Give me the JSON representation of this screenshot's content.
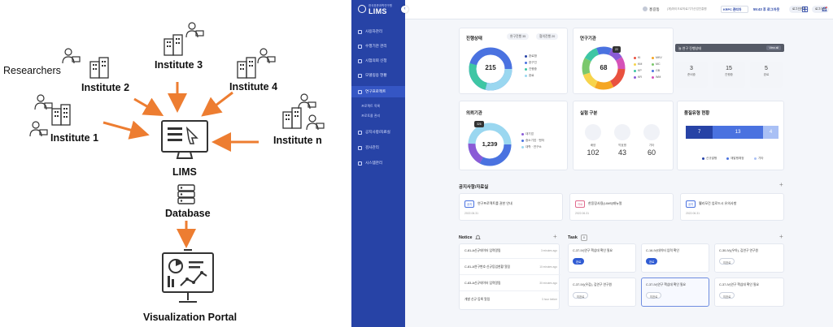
{
  "diagram": {
    "researchers_label": "Researchers",
    "institutes": [
      "Institute 1",
      "Institute 2",
      "Institute 3",
      "Institute 4",
      "Institute n"
    ],
    "lims_label": "LIMS",
    "database_label": "Database",
    "portal_label": "Visualization Portal",
    "arrow_color": "#ed7d31"
  },
  "app": {
    "brand": {
      "subtitle": "한국표준과학연구원",
      "name": "LIMS"
    },
    "sidebar": {
      "items": [
        "사용자관리",
        "수행기관 관리",
        "시험의뢰 신청",
        "모델링용 현황",
        "연구프로젝트",
        "공지사항/자료실",
        "검사관리",
        "시스템관리"
      ],
      "subitems": [
        "프로젝트 목록",
        "프로토콜 관리"
      ]
    },
    "topbar": {
      "user": "홍길동",
      "institution": "(재)마이크로의료기기산업진흥원",
      "select": "KRPC 관리자",
      "time": "55:43 후 로그아웃",
      "extend": "로그인연장",
      "logout": "로그아웃"
    },
    "progress": {
      "title": "진행상태",
      "pill1": "완구진행 35",
      "pill2": "협의진행 20",
      "total": "215",
      "legend": [
        "완료함",
        "완구진",
        "진행중",
        "완료"
      ]
    },
    "institutes_card": {
      "title": "연구기관",
      "total": "68",
      "tag": "22",
      "legend": [
        "KI",
        "MKV",
        "KM",
        "MC",
        "KP",
        "GB",
        "KR",
        "WM"
      ]
    },
    "status_card": {
      "header": "늘 연구 진행상태",
      "view_all": "View all",
      "boxes": [
        {
          "num": "3",
          "label": "준비중"
        },
        {
          "num": "15",
          "label": "진행중"
        },
        {
          "num": "5",
          "label": "완료"
        }
      ]
    },
    "requester_card": {
      "title": "의뢰기관",
      "total": "1,239",
      "tag": "326",
      "legend": [
        "대기업",
        "중소기업 · 벤처",
        "대학 · 연구소"
      ]
    },
    "experiment_card": {
      "title": "실험 구분",
      "items": [
        {
          "label": "배양",
          "num": "102"
        },
        {
          "label": "약효평",
          "num": "43"
        },
        {
          "label": "기타",
          "num": "60"
        }
      ]
    },
    "quality_card": {
      "title": "품질유형 현황",
      "segments": [
        {
          "value": 7,
          "color": "#2743a6"
        },
        {
          "value": 13,
          "color": "#4a72e0"
        },
        {
          "value": 4,
          "color": "#a9c0f5"
        }
      ],
      "legend": [
        "신규발행",
        "재발행예정",
        "기타"
      ]
    },
    "notices_section": {
      "title": "공지사항/자료실",
      "cards": [
        {
          "tag": "공지",
          "text": "연구프로젝트를 권한 안내",
          "date": "2022.06.31"
        },
        {
          "tag": "자료",
          "text": "한웅장사용(LIMS)매뉴얼",
          "date": "2022.06.31"
        },
        {
          "tag": "공지",
          "text": "웰리모건 업로드시 유의사항",
          "date": "2022.06.31"
        }
      ]
    },
    "notice_list": {
      "title": "Notice",
      "rows": [
        {
          "text": "C-81-A신규데이터 입력알림",
          "ago": "3 minutes ago"
        },
        {
          "text": "C-81-A연구변호 신규등업현황 알림",
          "ago": "10 minutes ago"
        },
        {
          "text": "C-83-A신규데이터 입력알림",
          "ago": "30 minutes ago"
        },
        {
          "text": "개발 신규 등록 알림",
          "ago": "3 hour before"
        }
      ]
    },
    "task_section": {
      "title": "Task",
      "count": "8",
      "cards": [
        {
          "text": "C-37-IV)연구 핵심데 확인 필요",
          "btn": "완료"
        },
        {
          "text": "C-16-IV)데이터 입력 확인",
          "btn": "완료"
        },
        {
          "text": "C-30-IV)(우아), 김연구 연구원",
          "btn": "미완료"
        },
        {
          "text": "C-37-IV)(우감), 김연구 연구원",
          "btn": "미완료"
        },
        {
          "text": "C-37-IV)연구 핵심데 확인 필요",
          "btn": "미완료"
        },
        {
          "text": "C-37-IV)연구 핵심데 확인 필요",
          "btn": "미완료"
        }
      ]
    }
  }
}
